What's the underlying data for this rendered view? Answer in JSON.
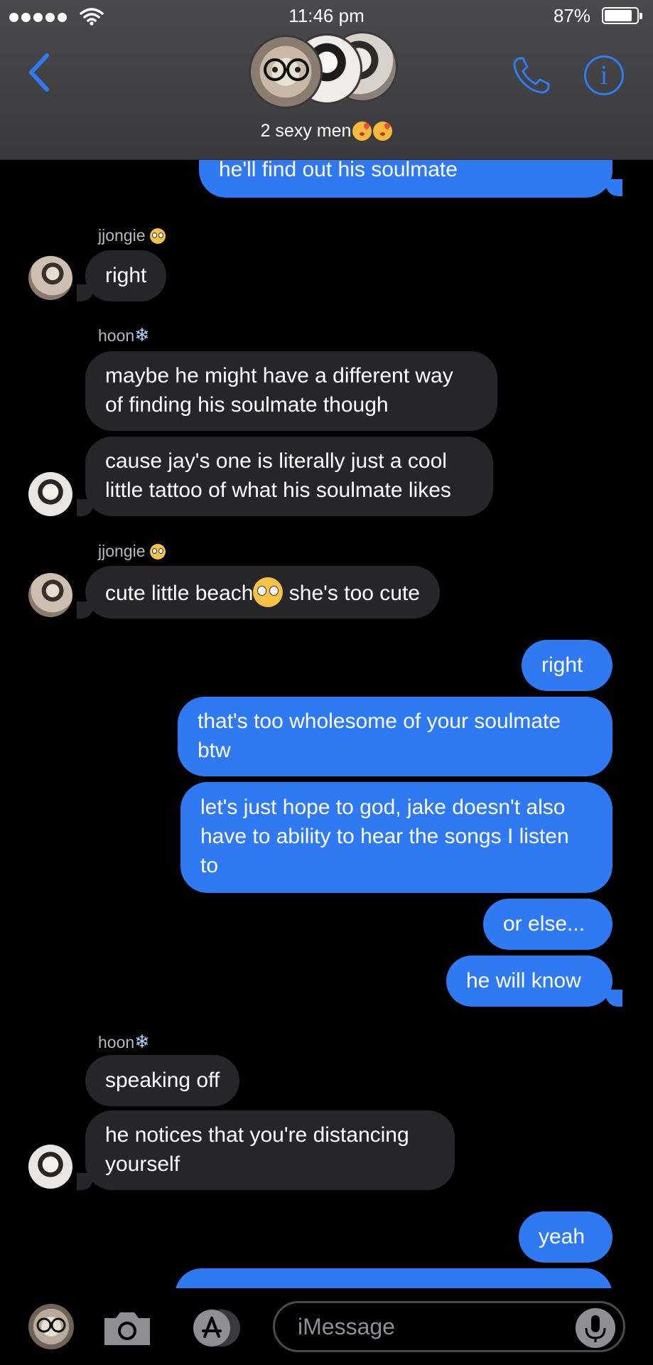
{
  "status": {
    "time": "11:46 pm",
    "battery": "87%",
    "battery_level": 0.87
  },
  "header": {
    "group_name": "2 sexy men",
    "back_icon": "chevron-left-icon",
    "call_icon": "phone-icon",
    "info_icon": "info-icon",
    "info_glyph": "i"
  },
  "messages": [
    {
      "from": "me",
      "text": "he'll find out his soulmate"
    },
    {
      "sender": "jjongie",
      "text": "right"
    },
    {
      "sender": "hoon",
      "text": "maybe he might have a different way\nof finding his soulmate though"
    },
    {
      "sender": "hoon",
      "text": "cause jay's one is literally just a cool\nlittle tattoo of what his soulmate likes"
    },
    {
      "sender": "jjongie",
      "text_before": "cute little beach",
      "text_after": " she's too cute"
    },
    {
      "from": "me",
      "text": "right"
    },
    {
      "from": "me",
      "text": "that's too wholesome of your soulmate\nbtw"
    },
    {
      "from": "me",
      "text": "let's just hope to god, jake doesn't also\nhave to ability to hear the songs I listen\nto"
    },
    {
      "from": "me",
      "text": "or else..."
    },
    {
      "from": "me",
      "text": "he will know"
    },
    {
      "sender": "hoon",
      "text": "speaking off"
    },
    {
      "sender": "hoon",
      "text": "he notices that you're distancing\nyourself"
    },
    {
      "from": "me",
      "text": "yeah"
    }
  ],
  "senders": {
    "jjongie": "jjongie",
    "hoon": "hoon"
  },
  "input": {
    "placeholder": "iMessage"
  },
  "colors": {
    "outgoing": "#2f79f2",
    "incoming": "#262628",
    "accent": "#2d7cf6"
  }
}
